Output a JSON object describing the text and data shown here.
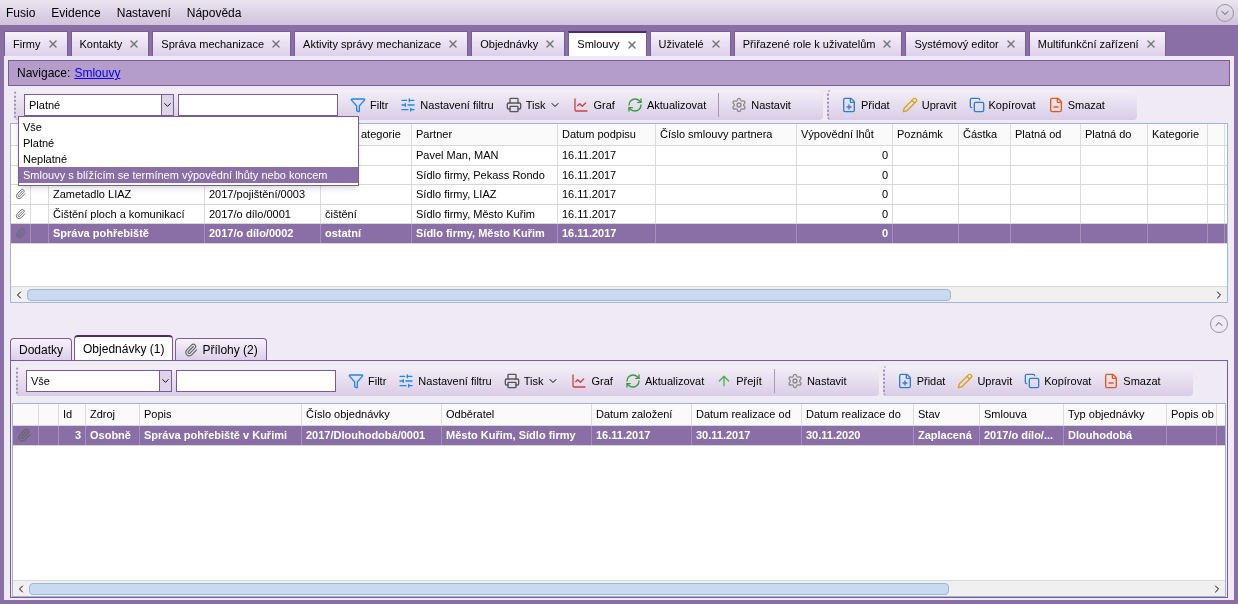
{
  "menu": [
    "Fusio",
    "Evidence",
    "Nastavení",
    "Nápověda"
  ],
  "tabs": [
    {
      "label": "Firmy",
      "selected": false
    },
    {
      "label": "Kontakty",
      "selected": false
    },
    {
      "label": "Správa mechanizace",
      "selected": false
    },
    {
      "label": "Aktivity správy mechanizace",
      "selected": false
    },
    {
      "label": "Objednávky",
      "selected": false
    },
    {
      "label": "Smlouvy",
      "selected": true
    },
    {
      "label": "Uživatelé",
      "selected": false
    },
    {
      "label": "Přiřazené role k uživatelům",
      "selected": false
    },
    {
      "label": "Systémový editor",
      "selected": false
    },
    {
      "label": "Multifunkční zařízení",
      "selected": false
    }
  ],
  "navigation": {
    "label": "Navigace:",
    "link": "Smlouvy"
  },
  "top_toolbar": {
    "filter_value": "Platné",
    "groups": [
      [
        {
          "kind": "filter",
          "label": "Filtr"
        },
        {
          "kind": "filter-settings",
          "label": "Nastavení filtru"
        },
        {
          "kind": "print",
          "label": "Tisk",
          "menu": true
        },
        {
          "kind": "chart",
          "label": "Graf"
        },
        {
          "kind": "refresh",
          "label": "Aktualizovat"
        },
        {
          "kind": "separator"
        },
        {
          "kind": "settings",
          "label": "Nastavit"
        }
      ],
      [
        {
          "kind": "add",
          "label": "Přidat"
        },
        {
          "kind": "edit",
          "label": "Upravit"
        },
        {
          "kind": "copy",
          "label": "Kopírovat"
        },
        {
          "kind": "delete",
          "label": "Smazat"
        }
      ]
    ]
  },
  "filter_dropdown": [
    {
      "label": "Vše",
      "selected": false
    },
    {
      "label": "Platné",
      "selected": false
    },
    {
      "label": "Neplatné",
      "selected": false
    },
    {
      "label": "Smlouvy s blížícím se termínem výpovědní lhůty nebo koncem",
      "selected": true
    }
  ],
  "top_table": {
    "columns": [
      {},
      {},
      {},
      {},
      {
        "label": "ategorie"
      },
      {
        "label": "Partner"
      },
      {
        "label": "Datum podpisu"
      },
      {
        "label": "Číslo smlouvy partnera"
      },
      {
        "label": "Výpovědní lhůt"
      },
      {
        "label": "Poznámk"
      },
      {
        "label": "Částka"
      },
      {
        "label": "Platná od"
      },
      {
        "label": "Platná do"
      },
      {
        "label": "Kategorie"
      },
      {}
    ],
    "rows": [
      {
        "selected": false,
        "cells": [
          "",
          "",
          "",
          "",
          "",
          "Pavel Man, MAN",
          "16.11.2017",
          "",
          "0"
        ]
      },
      {
        "selected": false,
        "cells": [
          "",
          "",
          "",
          "",
          "",
          "Sídlo firmy, Pekass Rondo",
          "16.11.2017",
          "",
          "0"
        ]
      },
      {
        "selected": false,
        "attachment": true,
        "cells": [
          "",
          "",
          "Zametadlo LIAZ",
          "2017/pojištění/0003",
          "",
          "Sídlo firmy, LIAZ",
          "16.11.2017",
          "",
          "0"
        ]
      },
      {
        "selected": false,
        "attachment": true,
        "cells": [
          "",
          "",
          "Čištění ploch a komunikací",
          "2017/o dílo/0001",
          "čištění",
          "Sídlo firmy, Město Kuřim",
          "16.11.2017",
          "",
          "0"
        ]
      },
      {
        "selected": true,
        "attachment": true,
        "cells": [
          "",
          "",
          "Správa pohřebiště",
          "2017/o dílo/0002",
          "ostatní",
          "Sídlo firmy, Město Kuřim",
          "16.11.2017",
          "",
          "0"
        ]
      }
    ]
  },
  "detail_tabs": [
    {
      "label": "Dodatky",
      "selected": false
    },
    {
      "label": "Objednávky (1)",
      "selected": true
    },
    {
      "label": "Přílohy (2)",
      "selected": false,
      "attachment": true
    }
  ],
  "bottom_toolbar": {
    "filter_value": "Vše",
    "groups": [
      [
        {
          "kind": "filter",
          "label": "Filtr"
        },
        {
          "kind": "filter-settings",
          "label": "Nastavení filtru"
        },
        {
          "kind": "print",
          "label": "Tisk",
          "menu": true
        },
        {
          "kind": "chart",
          "label": "Graf"
        },
        {
          "kind": "refresh",
          "label": "Aktualizovat"
        },
        {
          "kind": "go",
          "label": "Přejít"
        },
        {
          "kind": "separator"
        },
        {
          "kind": "settings",
          "label": "Nastavit"
        }
      ],
      [
        {
          "kind": "add",
          "label": "Přidat"
        },
        {
          "kind": "edit",
          "label": "Upravit"
        },
        {
          "kind": "copy",
          "label": "Kopírovat"
        },
        {
          "kind": "delete",
          "label": "Smazat"
        }
      ]
    ]
  },
  "bottom_table": {
    "columns": [
      {},
      {},
      {
        "label": "Id"
      },
      {
        "label": "Zdroj"
      },
      {
        "label": "Popis"
      },
      {
        "label": "Číslo objednávky"
      },
      {
        "label": "Odběratel"
      },
      {
        "label": "Datum založení"
      },
      {
        "label": "Datum realizace od"
      },
      {
        "label": "Datum realizace do"
      },
      {
        "label": "Stav"
      },
      {
        "label": "Smlouva"
      },
      {
        "label": "Typ objednávky"
      },
      {
        "label": "Popis ob"
      }
    ],
    "rows": [
      {
        "selected": true,
        "attachment": true,
        "cells": [
          "",
          "",
          "3",
          "Osobně",
          "Správa pohřebiště v Kuřimi",
          "2017/Dlouhodobá/0001",
          "Město Kuřim, Sídlo firmy",
          "16.11.2017",
          "30.11.2017",
          "30.11.2020",
          "Zaplacená",
          "2017/o dílo/...",
          "Dlouhodobá",
          ""
        ]
      }
    ]
  }
}
